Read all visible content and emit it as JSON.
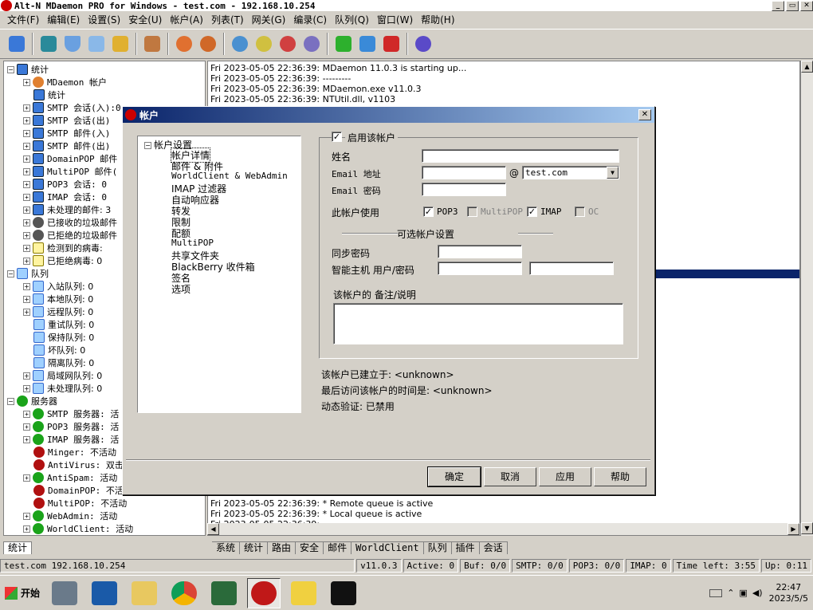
{
  "window": {
    "title": "Alt-N MDaemon PRO for Windows - test.com - 192.168.10.254"
  },
  "menu": [
    "文件(F)",
    "编辑(E)",
    "设置(S)",
    "安全(U)",
    "帐户(A)",
    "列表(T)",
    "网关(G)",
    "编录(C)",
    "队列(Q)",
    "窗口(W)",
    "帮助(H)"
  ],
  "tree": {
    "root": "统计",
    "items": [
      "MDaemon 帐户",
      "统计",
      "SMTP 会话(入):0",
      "SMTP 会话(出)",
      "SMTP 邮件(入)",
      "SMTP 邮件(出)",
      "DomainPOP 邮件",
      "MultiPOP 邮件(",
      "POP3 会话: 0",
      "IMAP 会话: 0",
      "未处理的邮件: 3",
      "已接收的垃圾邮件",
      "已拒绝的垃圾邮件",
      "检测到的病毒:",
      "已拒绝病毒: 0"
    ],
    "queue_root": "队列",
    "queues": [
      "入站队列: 0",
      "本地队列: 0",
      "远程队列: 0",
      "重试队列: 0",
      "保持队列: 0",
      "坏队列: 0",
      "隔离队列: 0",
      "局域网队列: 0",
      "未处理队列: 0"
    ],
    "server_root": "服务器",
    "servers": [
      "SMTP 服务器: 活",
      "POP3 服务器: 活",
      "IMAP 服务器: 活",
      "Minger: 不活动",
      "AntiVirus: 双击",
      "AntiSpam: 活动",
      "DomainPOP: 不活",
      "MultiPOP: 不活动",
      "WebAdmin: 活动",
      "WorldClient: 活动"
    ]
  },
  "log": {
    "top_lines": [
      "Fri 2023-05-05 22:36:39: MDaemon 11.0.3 is starting up...",
      "Fri 2023-05-05 22:36:39: ---------",
      "Fri 2023-05-05 22:36:39: MDaemon.exe v11.0.3",
      "Fri 2023-05-05 22:36:39: NTUtil.dll, v1103"
    ],
    "bottom_lines": [
      "Fri 2023-05-05 22:36:39: *  Remote queue is active",
      "Fri 2023-05-05 22:36:39: *  Local queue is active",
      "Fri 2023-05-05 22:36:39:"
    ]
  },
  "left_tabs": [
    "统计"
  ],
  "log_tabs": [
    "系统",
    "统计",
    "路由",
    "安全",
    "邮件",
    "WorldClient",
    "队列",
    "插件",
    "会话"
  ],
  "status": {
    "host": "test.com 192.168.10.254",
    "version": "v11.0.3",
    "active": "Active: 0",
    "buf": "Buf: 0/0",
    "smtp": "SMTP: 0/0",
    "pop3": "POP3: 0/0",
    "imap": "IMAP: 0",
    "time_left": "Time left: 3:55",
    "up": "Up: 0:11"
  },
  "taskbar": {
    "start": "开始",
    "time": "22:47",
    "date": "2023/5/5"
  },
  "dialog": {
    "title": "帐户",
    "close": "✕",
    "nav_root": "帐户设置",
    "nav_items": [
      "帐户详情",
      "邮件 & 附件",
      "WorldClient & WebAdmin",
      "IMAP 过滤器",
      "自动响应器",
      "转发",
      "限制",
      "配额",
      "MultiPOP",
      "共享文件夹",
      "BlackBerry 收件箱",
      "签名",
      "选项"
    ],
    "enable_account": "启用该帐户",
    "name_label": "姓名",
    "name_value": "",
    "email_label": "Email 地址",
    "email_value": "",
    "at": "@",
    "domain_value": "test.com",
    "password_label": "Email 密码",
    "password_value": "",
    "usage_label": "此帐户使用",
    "pop3": "POP3",
    "multipop": "MultiPOP",
    "imap": "IMAP",
    "oc": "OC",
    "optional_header": "可选帐户设置",
    "sync_password_label": "同步密码",
    "smarthost_label": "智能主机 用户/密码",
    "notes_label": "该帐户的 备注/说明",
    "created": "该帐户已建立于: <unknown>",
    "last_access": "最后访问该帐户的时间是: <unknown>",
    "dynamic_auth": "动态验证: 已禁用",
    "ok": "确定",
    "cancel": "取消",
    "apply": "应用",
    "help": "帮助"
  }
}
